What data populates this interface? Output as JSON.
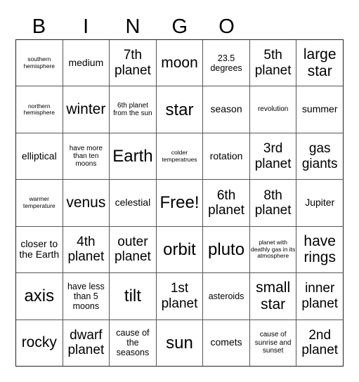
{
  "header": {
    "letters": [
      "B",
      "I",
      "N",
      "G",
      "O"
    ]
  },
  "board": {
    "rows": [
      [
        "southern hemisphere",
        "medium",
        "7th planet",
        "moon",
        "23.5 degrees",
        "5th planet",
        "large star"
      ],
      [
        "northern hemisphere",
        "winter",
        "6th planet from the sun",
        "star",
        "season",
        "revolution",
        "summer"
      ],
      [
        "elliptical",
        "have more than ten moons",
        "Earth",
        "colder temperatrues",
        "rotation",
        "3rd planet",
        "gas giants"
      ],
      [
        "warmer temperature",
        "venus",
        "celestial",
        "Free!",
        "6th planet",
        "8th planet",
        "Jupiter"
      ],
      [
        "closer to the Earth",
        "4th planet",
        "outer planet",
        "orbit",
        "pluto",
        "planet with deathly gas in its atmosphere",
        "have rings"
      ],
      [
        "axis",
        "have less than 5 moons",
        "tilt",
        "1st planet",
        "asteroids",
        "small star",
        "inner planet"
      ],
      [
        "rocky",
        "dwarf planet",
        "cause of the seasons",
        "sun",
        "comets",
        "cause of sunrise and sunset",
        "2nd planet"
      ]
    ]
  }
}
